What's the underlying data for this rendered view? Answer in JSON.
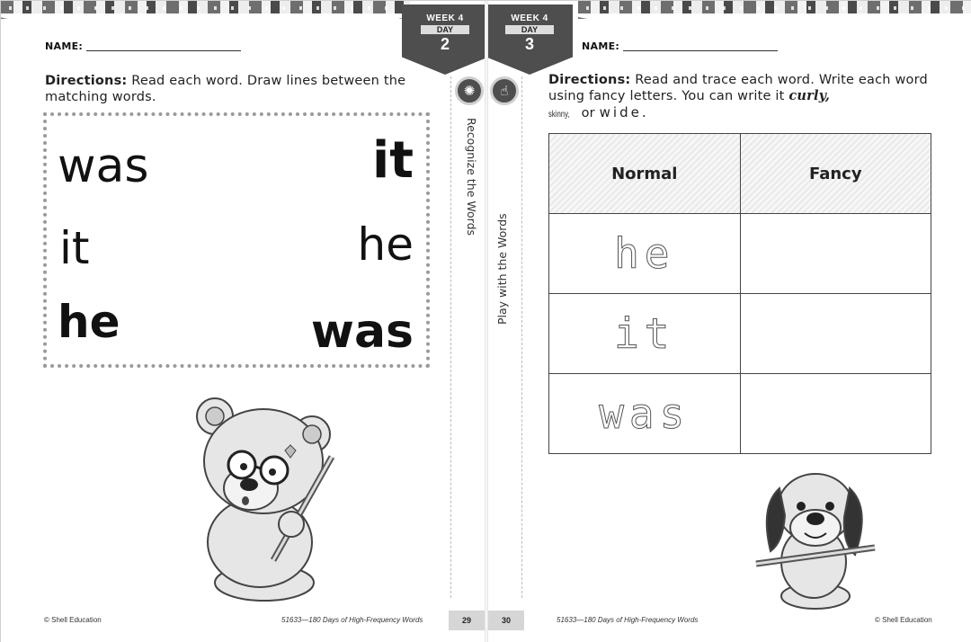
{
  "left_page": {
    "week_label": "WEEK 4",
    "day_label": "DAY",
    "day_number": "2",
    "name_label": "NAME:",
    "directions_bold": "Directions:",
    "directions_text": " Read each word.  Draw lines between the matching words.",
    "match_left": [
      "was",
      "it",
      "he"
    ],
    "match_right": [
      "it",
      "he",
      "was"
    ],
    "section_title": "Recognize the Words",
    "section_icon": "lightbulb-icon",
    "footer_left": "© Shell Education",
    "footer_center": "51633—180 Days of High-Frequency Words",
    "page_number": "29"
  },
  "right_page": {
    "week_label": "WEEK 4",
    "day_label": "DAY",
    "day_number": "3",
    "name_label": "NAME:",
    "directions_bold": "Directions:",
    "directions_text_1": " Read and trace each word.  Write each word using fancy letters.  You can write it ",
    "curly": "curly,",
    "skinny": "skinny,",
    "or": " or ",
    "wide": "wide.",
    "section_title": "Play with the Words",
    "section_icon": "pointing-hand-icon",
    "table": {
      "headers": [
        "Normal",
        "Fancy"
      ],
      "rows": [
        "he",
        "it",
        "was"
      ]
    },
    "page_number": "30",
    "footer_center": "51633—180 Days of High-Frequency Words",
    "footer_right": "© Shell Education"
  }
}
